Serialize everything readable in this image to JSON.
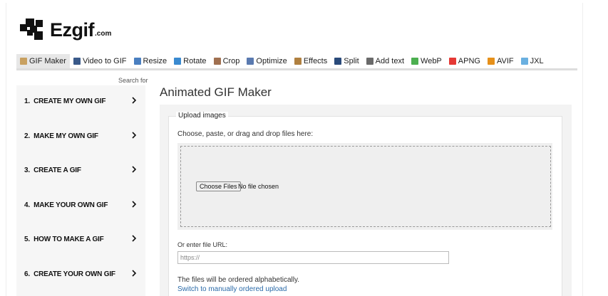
{
  "logo": {
    "name": "Ezgif",
    "tld": ".com"
  },
  "nav": {
    "items": [
      {
        "label": "GIF Maker",
        "icon": "gif-maker-icon",
        "color": "#c8a060",
        "active": true
      },
      {
        "label": "Video to GIF",
        "icon": "video-icon",
        "color": "#3a5a8a"
      },
      {
        "label": "Resize",
        "icon": "resize-icon",
        "color": "#4a7fc0"
      },
      {
        "label": "Rotate",
        "icon": "rotate-icon",
        "color": "#3a8ad0"
      },
      {
        "label": "Crop",
        "icon": "crop-icon",
        "color": "#a07050"
      },
      {
        "label": "Optimize",
        "icon": "optimize-icon",
        "color": "#5a7ab0"
      },
      {
        "label": "Effects",
        "icon": "effects-icon",
        "color": "#b08040"
      },
      {
        "label": "Split",
        "icon": "split-icon",
        "color": "#2a4a7a"
      },
      {
        "label": "Add text",
        "icon": "add-text-icon",
        "color": "#6a6a6a"
      },
      {
        "label": "WebP",
        "icon": "webp-icon",
        "color": "#4caf50"
      },
      {
        "label": "APNG",
        "icon": "apng-icon",
        "color": "#e53935"
      },
      {
        "label": "AVIF",
        "icon": "avif-icon",
        "color": "#e6901a"
      },
      {
        "label": "JXL",
        "icon": "jxl-icon",
        "color": "#6ab0e0"
      }
    ]
  },
  "sidebar": {
    "search_for": "Search for",
    "items": [
      {
        "label": "1.  CREATE MY OWN GIF"
      },
      {
        "label": "2.  MAKE MY OWN GIF"
      },
      {
        "label": "3.  CREATE A GIF"
      },
      {
        "label": "4.  MAKE YOUR OWN GIF"
      },
      {
        "label": "5.  HOW TO MAKE A GIF"
      },
      {
        "label": "6.  CREATE YOUR OWN GIF"
      }
    ]
  },
  "main": {
    "title": "Animated GIF Maker",
    "upload_legend": "Upload images",
    "choose_label": "Choose, paste, or drag and drop files here:",
    "choose_button": "Choose Files",
    "file_status": "No file chosen",
    "url_label": "Or enter file URL:",
    "url_placeholder": "https://",
    "order_note": "The files will be ordered alphabetically.",
    "switch_link": "Switch to manually ordered upload"
  }
}
